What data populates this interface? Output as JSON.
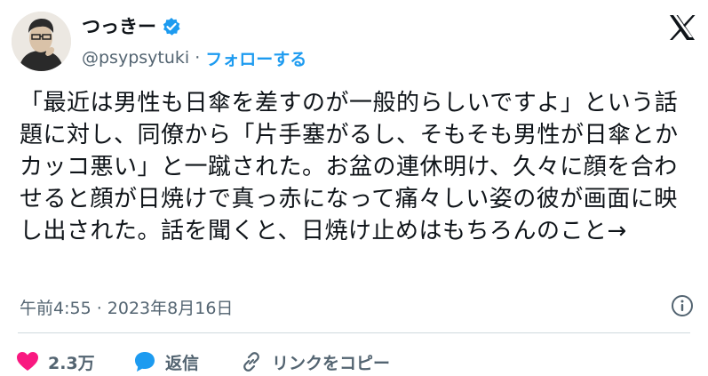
{
  "author": {
    "display_name": "つっきー",
    "handle": "@psypsytuki",
    "separator": "·",
    "follow_label": "フォローする"
  },
  "tweet": {
    "text": "「最近は男性も日傘を差すのが一般的らしいですよ」という話題に対し、同僚から「片手塞がるし、そもそも男性が日傘とかカッコ悪い」と一蹴された。お盆の連休明け、久々に顔を合わせると顔が日焼けで真っ赤になって痛々しい姿の彼が画面に映し出された。話を聞くと、日焼け止めはもちろんのこと→",
    "timestamp": "午前4:55 · 2023年8月16日"
  },
  "actions": {
    "like_count": "2.3万",
    "reply_label": "返信",
    "copy_link_label": "リンクをコピー"
  },
  "colors": {
    "accent": "#1d9bf0",
    "like": "#f91880",
    "secondary_text": "#536471",
    "primary_text": "#0f1419"
  },
  "icons": [
    "verified-badge-icon",
    "x-logo-icon",
    "info-icon",
    "heart-icon",
    "reply-bubble-icon",
    "link-icon"
  ]
}
